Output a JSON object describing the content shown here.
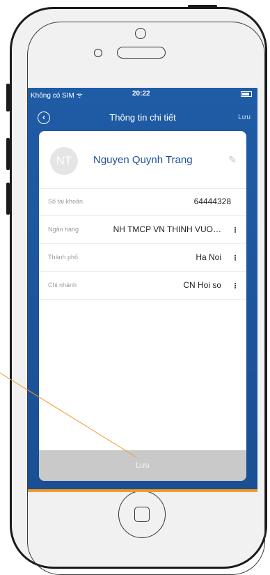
{
  "status_bar": {
    "carrier": "Không có SIM ᯤ",
    "time": "20:22"
  },
  "nav": {
    "title": "Thông tin chi tiết",
    "save_label": "Lưu",
    "back_icon": "back-circle-icon"
  },
  "profile": {
    "initials": "NT",
    "name": "Nguyen Quynh Trang",
    "edit_icon": "pencil-icon"
  },
  "fields": {
    "account": {
      "label": "Số tài khoản",
      "value": "64444328"
    },
    "bank": {
      "label": "Ngân hàng",
      "value": "NH TMCP VN THINH VUO…"
    },
    "city": {
      "label": "Thành phố",
      "value": "Ha Noi"
    },
    "branch": {
      "label": "Chi nhánh",
      "value": "CN Hoi so"
    }
  },
  "save_button": {
    "label": "Lưu"
  },
  "colors": {
    "screen_blue": "#1f5ca6",
    "accent_orange": "#f29b2a",
    "name_blue": "#1d4f9a",
    "disabled_gray": "#c9c9c9"
  }
}
